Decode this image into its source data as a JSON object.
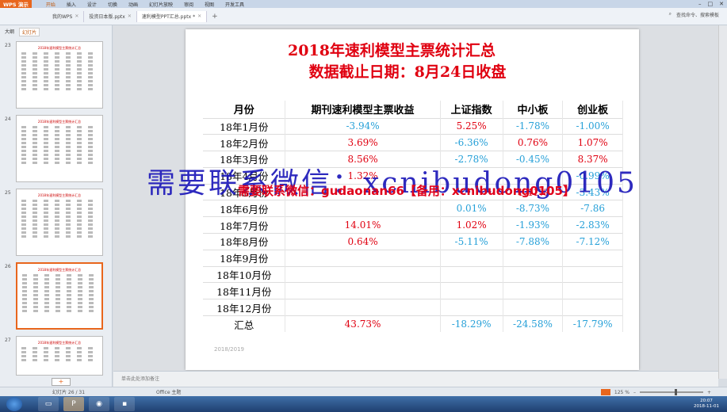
{
  "titlebar": {
    "app_label": "WPS 演示",
    "menu": [
      "开始",
      "插入",
      "设计",
      "切换",
      "动画",
      "幻灯片放映",
      "审阅",
      "视图",
      "开发工具"
    ],
    "active_menu": "开始"
  },
  "tabs": [
    {
      "label": "我的WPS"
    },
    {
      "label": "投资日本版.pptx"
    },
    {
      "label": "速利模型PPT汇总.pptx *"
    }
  ],
  "right_tools": {
    "search": "查找命令、搜索模板"
  },
  "left_pane": {
    "tabs": [
      "大纲",
      "幻灯片"
    ],
    "selected_tab": "幻灯片",
    "thumbnails": [
      {
        "num": "23",
        "title": "2018年速利模型主票统计汇总"
      },
      {
        "num": "24",
        "title": "2018年速利模型主票统计汇总"
      },
      {
        "num": "25",
        "title": "2018年速利模型主票统计汇总"
      },
      {
        "num": "26",
        "title": "2018年速利模型主票统计汇总"
      },
      {
        "num": "27",
        "title": "2018年速利模型主票统计汇总"
      }
    ],
    "add_label": "+"
  },
  "slide": {
    "title_line1": "2018年速利模型主票统计汇总",
    "title_line2": "数据截止日期：8月24日收盘",
    "headers": [
      "月份",
      "期刊速利模型主票收益",
      "上证指数",
      "中小板",
      "创业板"
    ],
    "rows": [
      {
        "month": "18年1月份",
        "a": "-3.94%",
        "b": "5.25%",
        "c": "-1.78%",
        "d": "-1.00%",
        "ac": "blue",
        "bc": "red",
        "cc": "blue",
        "dc": "blue"
      },
      {
        "month": "18年2月份",
        "a": "3.69%",
        "b": "-6.36%",
        "c": "0.76%",
        "d": "1.07%",
        "ac": "red",
        "bc": "blue",
        "cc": "red",
        "dc": "red"
      },
      {
        "month": "18年3月份",
        "a": "8.56%",
        "b": "-2.78%",
        "c": "-0.45%",
        "d": "8.37%",
        "ac": "red",
        "bc": "blue",
        "cc": "blue",
        "dc": "red"
      },
      {
        "month": "18年4月份",
        "a": "1.32%",
        "b": "",
        "c": "",
        "d": "-0.99%",
        "ac": "red",
        "bc": "blue",
        "cc": "blue",
        "dc": "blue"
      },
      {
        "month": "18年5月份",
        "a": "",
        "b": "",
        "c": "1.41%",
        "d": "-3.43%",
        "ac": "red",
        "bc": "blue",
        "cc": "red",
        "dc": "blue"
      },
      {
        "month": "18年6月份",
        "a": "",
        "b": "0.01%",
        "c": "-8.73%",
        "d": "-7.86",
        "ac": "red",
        "bc": "blue",
        "cc": "blue",
        "dc": "blue"
      },
      {
        "month": "18年7月份",
        "a": "14.01%",
        "b": "1.02%",
        "c": "-1.93%",
        "d": "-2.83%",
        "ac": "red",
        "bc": "red",
        "cc": "blue",
        "dc": "blue"
      },
      {
        "month": "18年8月份",
        "a": "0.64%",
        "b": "-5.11%",
        "c": "-7.88%",
        "d": "-7.12%",
        "ac": "red",
        "bc": "blue",
        "cc": "blue",
        "dc": "blue"
      },
      {
        "month": "18年9月份",
        "a": "",
        "b": "",
        "c": "",
        "d": "",
        "ac": "red",
        "bc": "blue",
        "cc": "blue",
        "dc": "blue"
      },
      {
        "month": "18年10月份",
        "a": "",
        "b": "",
        "c": "",
        "d": "",
        "ac": "red",
        "bc": "blue",
        "cc": "blue",
        "dc": "blue"
      },
      {
        "month": "18年11月份",
        "a": "",
        "b": "",
        "c": "",
        "d": "",
        "ac": "red",
        "bc": "blue",
        "cc": "blue",
        "dc": "blue"
      },
      {
        "month": "18年12月份",
        "a": "",
        "b": "",
        "c": "",
        "d": "",
        "ac": "red",
        "bc": "blue",
        "cc": "blue",
        "dc": "blue"
      },
      {
        "month": "汇总",
        "a": "43.73%",
        "b": "-18.29%",
        "c": "-24.58%",
        "d": "-17.79%",
        "ac": "red",
        "bc": "blue",
        "cc": "blue",
        "dc": "blue"
      }
    ],
    "footer": "2018/2019",
    "watermark_blue": "需要联系微信：xcnibudong0105",
    "watermark_red": "需要联系微信：gudaonan66【备用：xcnibudong0105】"
  },
  "notes_placeholder": "单击此处添加备注",
  "statusbar": {
    "slide_info": "幻灯片 26 / 31",
    "theme": "Office 主题",
    "zoom": "125 %"
  },
  "taskbar": {
    "time": "20:07",
    "date": "2018-11-01"
  },
  "colors": {
    "accent": "#e8661d",
    "positive": "#e00010",
    "negative": "#26a0d8"
  }
}
